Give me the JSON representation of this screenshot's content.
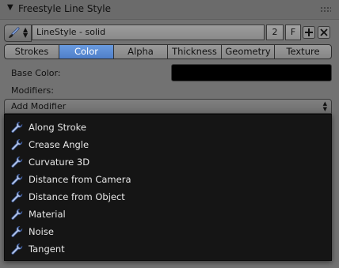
{
  "panel": {
    "title": "Freestyle Line Style",
    "arrow_glyph": "▼"
  },
  "linestyle": {
    "name": "LineStyle - solid",
    "users": "2",
    "fake_user": "F",
    "browse_icon": "brush-icon",
    "new_icon": "plus-icon",
    "unlink_icon": "x-icon"
  },
  "tabs": [
    {
      "label": "Strokes",
      "active": false
    },
    {
      "label": "Color",
      "active": true
    },
    {
      "label": "Alpha",
      "active": false
    },
    {
      "label": "Thickness",
      "active": false
    },
    {
      "label": "Geometry",
      "active": false
    },
    {
      "label": "Texture",
      "active": false
    }
  ],
  "base_color": {
    "label": "Base Color:",
    "value": "#000000"
  },
  "modifiers": {
    "label": "Modifiers:",
    "add_label": "Add Modifier",
    "items": [
      "Along Stroke",
      "Crease Angle",
      "Curvature 3D",
      "Distance from Camera",
      "Distance from Object",
      "Material",
      "Noise",
      "Tangent"
    ]
  },
  "colors": {
    "accent": "#5a8ad4",
    "menu_bg": "#151515",
    "menu_text": "#e6e6e6",
    "panel_bg": "#727272"
  }
}
